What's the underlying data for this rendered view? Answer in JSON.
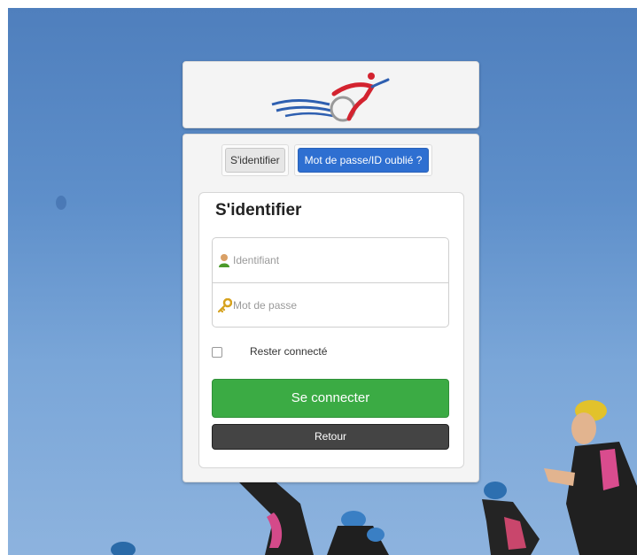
{
  "logo": {
    "icon": "triathlon-cyclist-logo"
  },
  "tabs": [
    {
      "label": "S'identifier",
      "active": true
    },
    {
      "label": "Mot de passe/ID oublié ?",
      "active": false
    }
  ],
  "form": {
    "title": "S'identifier",
    "username": {
      "placeholder": "Identifiant",
      "value": "",
      "icon": "user-icon"
    },
    "password": {
      "placeholder": "Mot de passe",
      "value": "",
      "icon": "key-icon"
    },
    "remember": {
      "label": "Rester connecté",
      "checked": false
    },
    "login_label": "Se connecter",
    "back_label": "Retour"
  },
  "colors": {
    "primary": "#2e6fd1",
    "success": "#3bab44",
    "dark": "#444444",
    "background_sky": "#5e8fca"
  }
}
